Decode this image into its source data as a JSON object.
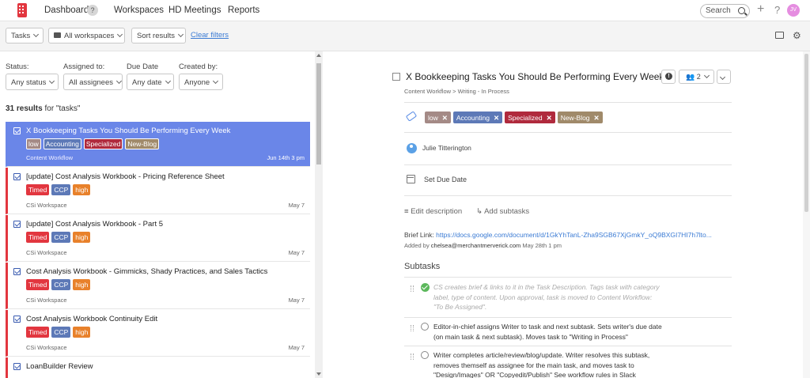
{
  "nav": {
    "dashboard": "Dashboard",
    "dashboard_badge": "?",
    "workspaces": "Workspaces",
    "hd_meetings": "HD Meetings",
    "reports": "Reports",
    "search_placeholder": "Search",
    "plus": "+",
    "help": "?",
    "avatar_initials": "JV"
  },
  "toolbar": {
    "tasks": "Tasks",
    "workspaces": "All workspaces",
    "sort": "Sort results",
    "clear": "Clear filters"
  },
  "filters": {
    "status_label": "Status:",
    "status_value": "Any status",
    "assigned_label": "Assigned to:",
    "assigned_value": "All assignees",
    "due_label": "Due Date",
    "due_value": "Any date",
    "created_label": "Created by:",
    "created_value": "Anyone"
  },
  "results": {
    "count": "31 results",
    "suffix": "for \"tasks\""
  },
  "tasks": [
    {
      "title": "X Bookkeeping Tasks You Should Be Performing Every Week",
      "tags": [
        "low",
        "Accounting",
        "Specialized",
        "New-Blog"
      ],
      "workspace": "Content Workflow",
      "date": "Jun 14th 3 pm"
    },
    {
      "title": "[update] Cost Analysis Workbook - Pricing Reference Sheet",
      "tags": [
        "Timed",
        "CCP",
        "high"
      ],
      "workspace": "CSi Workspace",
      "date": "May 7"
    },
    {
      "title": "[update] Cost Analysis Workbook - Part 5",
      "tags": [
        "Timed",
        "CCP",
        "high"
      ],
      "workspace": "CSi Workspace",
      "date": "May 7"
    },
    {
      "title": "Cost Analysis Workbook - Gimmicks, Shady Practices, and Sales Tactics",
      "tags": [
        "Timed",
        "CCP",
        "high"
      ],
      "workspace": "CSi Workspace",
      "date": "May 7"
    },
    {
      "title": "Cost Analysis Workbook Continuity Edit",
      "tags": [
        "Timed",
        "CCP",
        "high"
      ],
      "workspace": "CSi Workspace",
      "date": "May 7"
    },
    {
      "title": "LoanBuilder Review",
      "tags": [],
      "workspace": "",
      "date": ""
    }
  ],
  "tag_colors": {
    "low": "#a48a86",
    "Accounting": "#5d79b7",
    "Specialized": "#b02a3d",
    "New-Blog": "#a08a6a",
    "Timed": "#e2363f",
    "CCP": "#5d79b7",
    "high": "#e8812b"
  },
  "detail": {
    "title": "X Bookkeeping Tasks You Should Be Performing Every Week",
    "breadcrumb": "Content Workflow > Writing - In Process",
    "members_count": "2",
    "tags": [
      "low",
      "Accounting",
      "Specialized",
      "New-Blog"
    ],
    "tag_close": "✕",
    "assignee": "Julie Titterington",
    "due": "Set Due Date",
    "edit_description": "Edit description",
    "add_subtasks": "Add subtasks",
    "brief_label": "Brief Link:",
    "brief_url": "https://docs.google.com/document/d/1GkYhTanL-Zha9SGB67XjGmkY_oQ9BXGI7HI7h7lto...",
    "added_prefix": "Added by",
    "added_by": "chelsea@merchantmerverick.com",
    "added_date": "May 28th 1 pm",
    "subtasks_header": "Subtasks",
    "subtasks": [
      "CS creates brief & links to it in the Task Description. Tags task with category label, type of content. Upon approval, task is moved to Content Workflow: \"To Be Assigned\".",
      "Editor-in-chief assigns Writer to task and next subtask. Sets writer's due date (on main task & next subtask). Moves task to \"Writing in Process\"",
      "Writer completes article/review/blog/update. Writer resolves this subtask, removes themself as assignee for the main task, and moves task to \"Design/Images\" OR \"Copyedit/Publish\" See workflow rules in Slack"
    ]
  }
}
